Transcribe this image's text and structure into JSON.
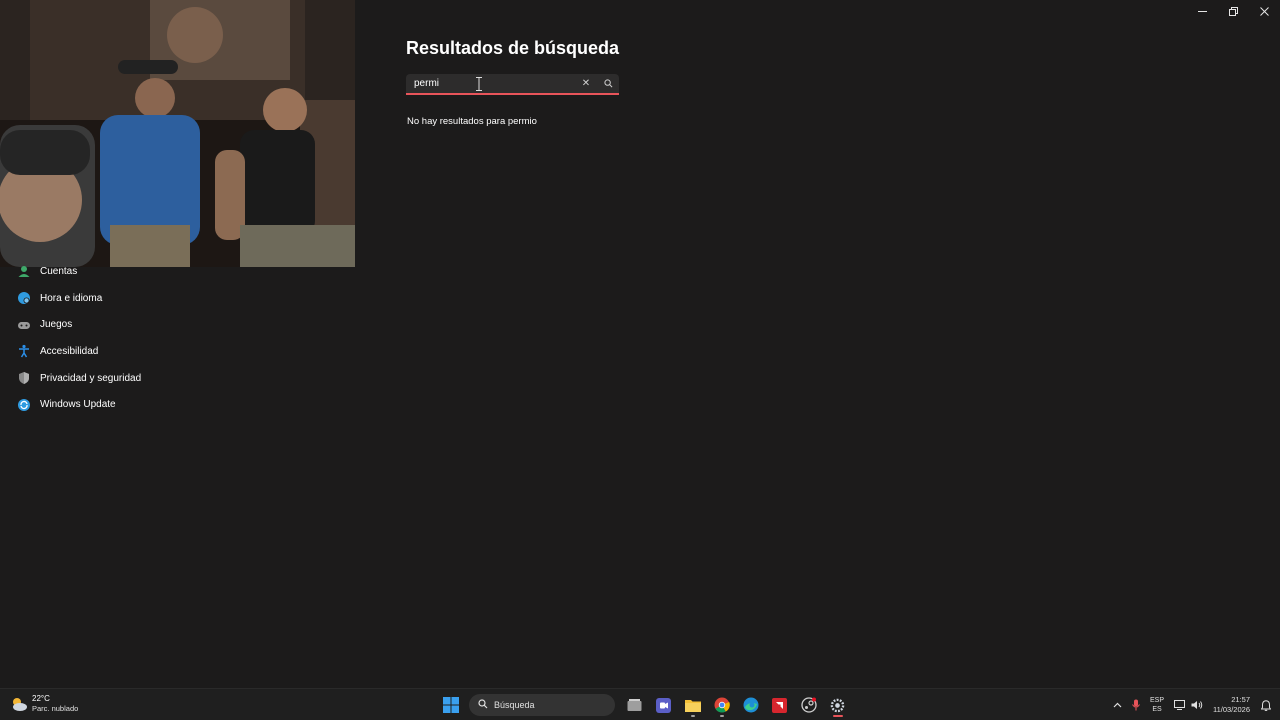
{
  "window": {
    "controls": [
      "minimize",
      "restore",
      "close"
    ]
  },
  "sidebar": {
    "items": [
      {
        "label": "Cuentas",
        "icon": "accounts-icon",
        "color": "#3ea96a"
      },
      {
        "label": "Hora e idioma",
        "icon": "time-language-icon",
        "color": "#2f9be0"
      },
      {
        "label": "Juegos",
        "icon": "gamepad-icon",
        "color": "#9a9a9a"
      },
      {
        "label": "Accesibilidad",
        "icon": "accessibility-icon",
        "color": "#2b8fe8"
      },
      {
        "label": "Privacidad y seguridad",
        "icon": "shield-icon",
        "color": "#8a8a8a"
      },
      {
        "label": "Windows Update",
        "icon": "windows-update-icon",
        "color": "#2f9be0"
      }
    ]
  },
  "main": {
    "title": "Resultados de búsqueda",
    "search": {
      "value": "permi",
      "clear_icon": "close-icon",
      "search_icon": "search-icon",
      "accent": "#e8545a"
    },
    "no_results": "No hay resultados para permio"
  },
  "taskbar": {
    "weather": {
      "temp": "22°C",
      "desc": "Parc. nublado"
    },
    "search_label": "Búsqueda",
    "apps": [
      "windows-start-icon",
      "task-view-icon",
      "teams-icon",
      "file-explorer-icon",
      "chrome-icon",
      "edge-icon",
      "amd-icon",
      "steam-icon",
      "settings-icon"
    ],
    "tray": {
      "lang_top": "ESP",
      "lang_bottom": "ES",
      "time": "21:57",
      "date": "11/03/2026"
    }
  }
}
